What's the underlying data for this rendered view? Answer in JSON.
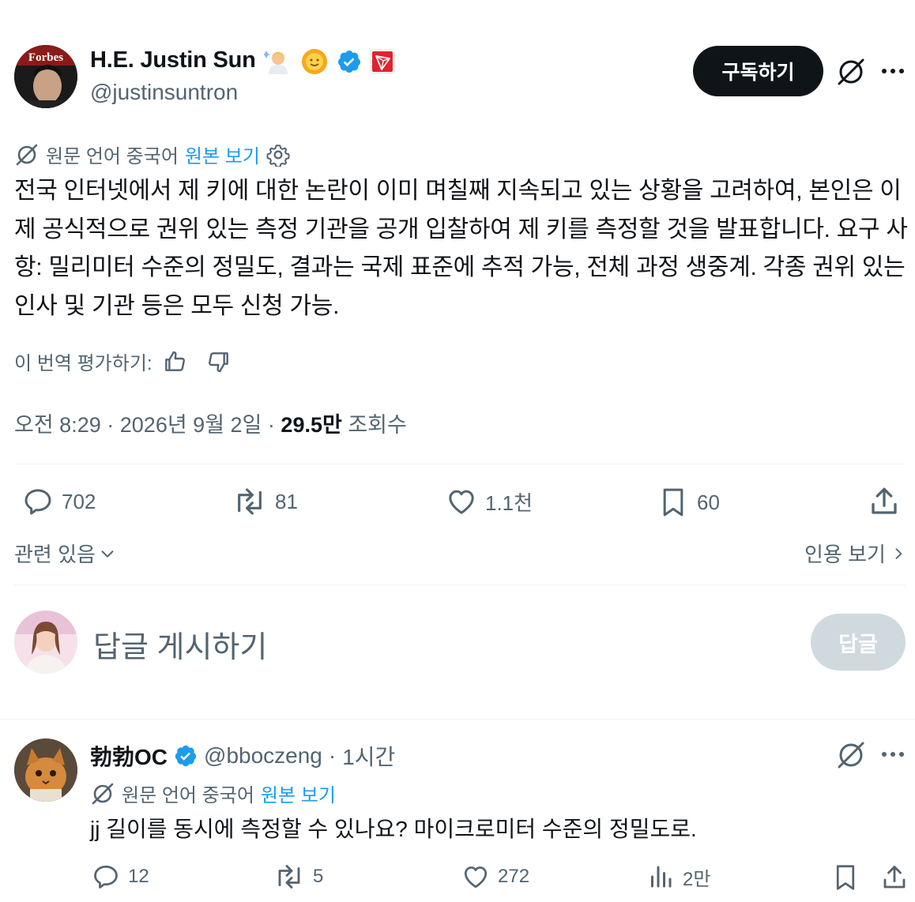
{
  "author": {
    "display_name": "H.E. Justin Sun",
    "handle": "@justinsuntron",
    "avatar_text": "Forbes",
    "badges": [
      "scientist-emoji",
      "sun-emoji",
      "verified-badge-icon",
      "tron-logo-icon"
    ]
  },
  "header": {
    "subscribe_label": "구독하기"
  },
  "translation": {
    "label": "원문 언어 중국어",
    "show_original": "원본 보기"
  },
  "tweet": {
    "text": "전국 인터넷에서 제 키에 대한 논란이 이미 며칠째 지속되고 있는 상황을 고려하여, 본인은 이제 공식적으로 권위 있는 측정 기관을 공개 입찰하여 제 키를 측정할 것을 발표합니다. 요구 사항: 밀리미터 수준의 정밀도, 결과는 국제 표준에 추적 가능, 전체 과정 생중계. 각종 권위 있는 인사 및 기관 등은 모두 신청 가능.",
    "rate_label": "이 번역 평가하기:",
    "time": "오전 8:29",
    "date": "2026년 9월 2일",
    "views_count": "29.5만",
    "views_label": "조회수",
    "separator": "·"
  },
  "actions": {
    "replies": "702",
    "retweets": "81",
    "likes": "1.1천",
    "bookmarks": "60"
  },
  "related": {
    "related_label": "관련 있음",
    "quotes_label": "인용 보기"
  },
  "compose": {
    "placeholder": "답글 게시하기",
    "reply_button": "답글"
  },
  "reply": {
    "display_name": "勃勃OC",
    "handle": "@bboczeng",
    "separator": "·",
    "time": "1시간",
    "translation_label": "원문 언어 중국어",
    "show_original": "원본 보기",
    "text": "jj 길이를 동시에 측정할 수 있나요? 마이크로미터 수준의 정밀도로.",
    "replies": "12",
    "retweets": "5",
    "likes": "272",
    "views": "2만"
  },
  "colors": {
    "text": "#0f1419",
    "muted": "#536471",
    "accent": "#1d9bf0",
    "divider": "#eff3f4",
    "disabled_button": "#cfd9de"
  }
}
